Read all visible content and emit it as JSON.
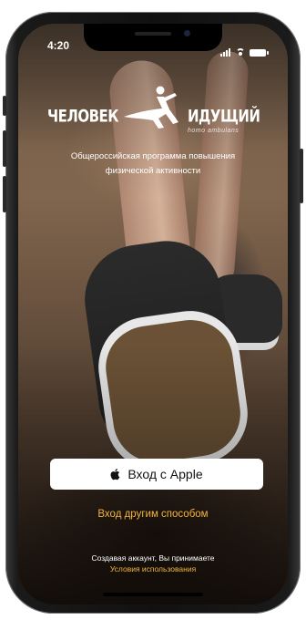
{
  "status_bar": {
    "time": "4:20"
  },
  "brand": {
    "left_word": "ЧЕЛОВЕК",
    "right_word": "ИДУЩИЙ",
    "latin": "homo ambulans"
  },
  "tagline": {
    "line1": "Общероссийская программа повышения",
    "line2": "физической активности"
  },
  "actions": {
    "apple_login": "Вход с Apple",
    "other_login": "Вход другим способом"
  },
  "terms": {
    "text": "Создавая аккаунт, Вы принимаете",
    "link": "Условия использования"
  },
  "colors": {
    "accent": "#f2b43c",
    "button_bg": "#ffffff"
  }
}
